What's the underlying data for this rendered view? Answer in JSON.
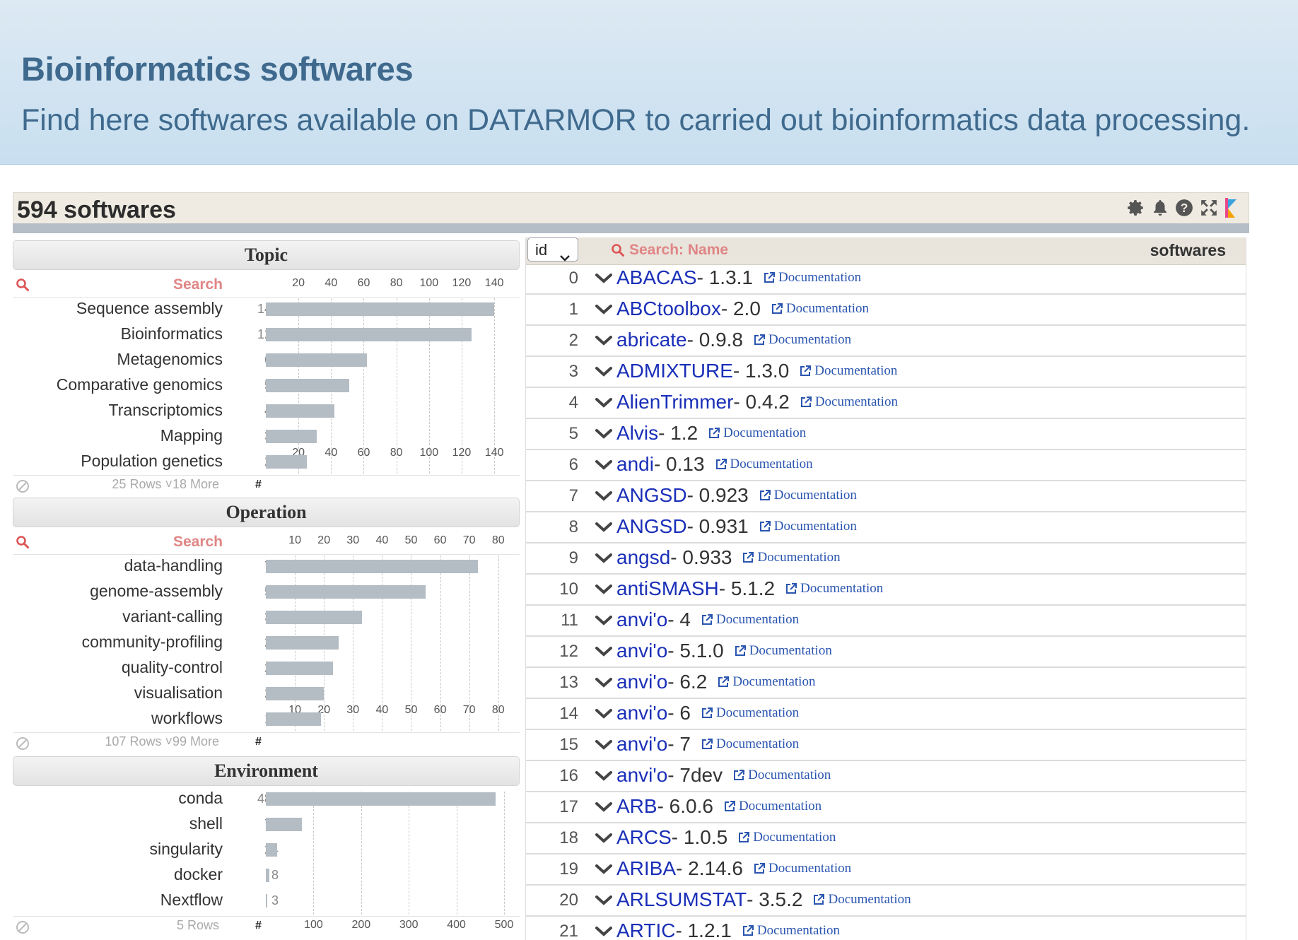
{
  "header": {
    "title": "Bioinformatics softwares",
    "subtitle": "Find here softwares available on DATARMOR to carried out bioinformatics data processing."
  },
  "panel": {
    "count_label": "594 softwares",
    "icons": [
      "gear-icon",
      "bell-icon",
      "help-icon",
      "expand-icon",
      "kibana-logo-icon"
    ]
  },
  "facets": {
    "topic": {
      "title": "Topic",
      "search_label": "Search",
      "ticks": [
        "20",
        "40",
        "60",
        "80",
        "100",
        "120",
        "140"
      ],
      "tick_values": [
        20,
        40,
        60,
        80,
        100,
        120,
        140
      ],
      "axis_max": 146,
      "rows": [
        {
          "label": "Sequence assembly",
          "value": 140,
          "value_text": "140"
        },
        {
          "label": "Bioinformatics",
          "value": 126,
          "value_text": "126"
        },
        {
          "label": "Metagenomics",
          "value": 62,
          "value_text": "62"
        },
        {
          "label": "Comparative genomics",
          "value": 51,
          "value_text": "51"
        },
        {
          "label": "Transcriptomics",
          "value": 42,
          "value_text": "42"
        },
        {
          "label": "Mapping",
          "value": 31,
          "value_text": "31"
        },
        {
          "label": "Population genetics",
          "value": 25,
          "value_text": "25"
        }
      ],
      "footer": "25 Rows ˅18 More",
      "hash": "#"
    },
    "operation": {
      "title": "Operation",
      "search_label": "Search",
      "ticks": [
        "10",
        "20",
        "30",
        "40",
        "50",
        "60",
        "70",
        "80"
      ],
      "tick_values": [
        10,
        20,
        30,
        40,
        50,
        60,
        70,
        80
      ],
      "axis_max": 82,
      "rows": [
        {
          "label": "data-handling",
          "value": 73,
          "value_text": "73"
        },
        {
          "label": "genome-assembly",
          "value": 55,
          "value_text": "55"
        },
        {
          "label": "variant-calling",
          "value": 33,
          "value_text": "33"
        },
        {
          "label": "community-profiling",
          "value": 25,
          "value_text": "25"
        },
        {
          "label": "quality-control",
          "value": 23,
          "value_text": "23"
        },
        {
          "label": "visualisation",
          "value": 20,
          "value_text": "20"
        },
        {
          "label": "workflows",
          "value": 19,
          "value_text": "19"
        }
      ],
      "footer": "107 Rows ˅99 More",
      "hash": "#"
    },
    "environment": {
      "title": "Environment",
      "ticks": [
        "100",
        "200",
        "300",
        "400",
        "500"
      ],
      "tick_values": [
        100,
        200,
        300,
        400,
        500
      ],
      "axis_max": 500,
      "rows": [
        {
          "label": "conda",
          "value": 482,
          "value_text": "482"
        },
        {
          "label": "shell",
          "value": 76,
          "value_text": "76"
        },
        {
          "label": "singularity",
          "value": 24,
          "value_text": "24"
        },
        {
          "label": "docker",
          "value": 8,
          "value_text": "8"
        },
        {
          "label": "Nextflow",
          "value": 3,
          "value_text": "3"
        }
      ],
      "footer": "5 Rows",
      "hash": "#"
    }
  },
  "table": {
    "sort_select": "id",
    "search_label": "Search: Name",
    "column_label": "softwares",
    "doc_label": "Documentation",
    "rows": [
      {
        "id": "0",
        "name": "ABACAS",
        "version": " - 1.3.1"
      },
      {
        "id": "1",
        "name": "ABCtoolbox",
        "version": " - 2.0"
      },
      {
        "id": "2",
        "name": "abricate",
        "version": " - 0.9.8"
      },
      {
        "id": "3",
        "name": "ADMIXTURE",
        "version": " - 1.3.0"
      },
      {
        "id": "4",
        "name": "AlienTrimmer",
        "version": " - 0.4.2"
      },
      {
        "id": "5",
        "name": "Alvis",
        "version": " - 1.2"
      },
      {
        "id": "6",
        "name": "andi",
        "version": " - 0.13"
      },
      {
        "id": "7",
        "name": "ANGSD",
        "version": " - 0.923"
      },
      {
        "id": "8",
        "name": "ANGSD",
        "version": " - 0.931"
      },
      {
        "id": "9",
        "name": "angsd",
        "version": " - 0.933"
      },
      {
        "id": "10",
        "name": "antiSMASH",
        "version": " - 5.1.2"
      },
      {
        "id": "11",
        "name": "anvi'o",
        "version": " - 4"
      },
      {
        "id": "12",
        "name": "anvi'o",
        "version": " - 5.1.0"
      },
      {
        "id": "13",
        "name": "anvi'o",
        "version": " - 6.2"
      },
      {
        "id": "14",
        "name": "anvi'o",
        "version": " - 6"
      },
      {
        "id": "15",
        "name": "anvi'o",
        "version": " - 7"
      },
      {
        "id": "16",
        "name": "anvi'o",
        "version": " - 7dev"
      },
      {
        "id": "17",
        "name": "ARB",
        "version": " - 6.0.6"
      },
      {
        "id": "18",
        "name": "ARCS",
        "version": " - 1.0.5"
      },
      {
        "id": "19",
        "name": "ARIBA",
        "version": " - 2.14.6"
      },
      {
        "id": "20",
        "name": "ARLSUMSTAT",
        "version": " - 3.5.2"
      },
      {
        "id": "21",
        "name": "ARTIC",
        "version": " - 1.2.1"
      }
    ]
  },
  "colors": {
    "accent": "#3f6a8e",
    "link": "#1a2fb8",
    "search": "#e08585",
    "bar": "#b4bcc4"
  }
}
